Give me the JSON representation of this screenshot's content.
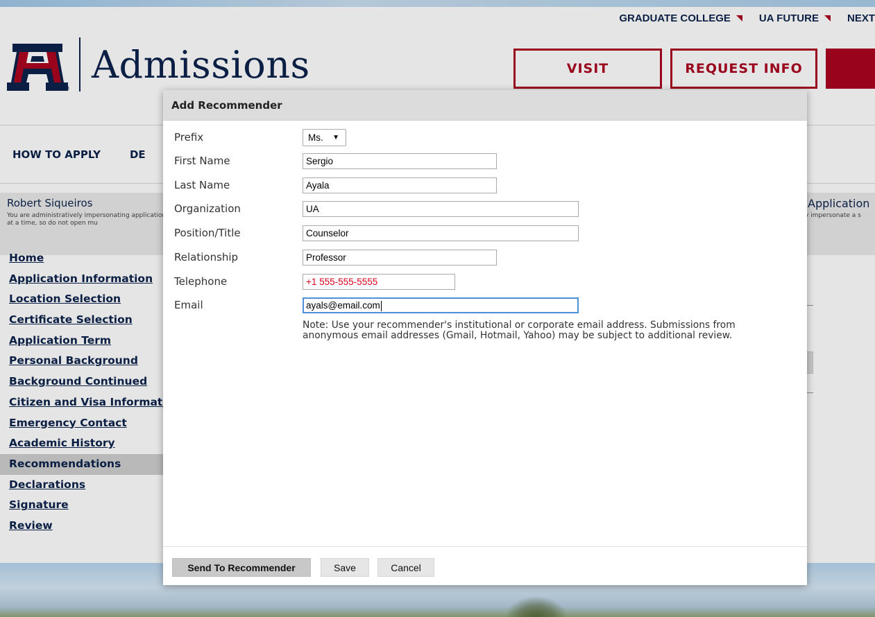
{
  "top_nav": {
    "items": [
      "GRADUATE COLLEGE",
      "UA FUTURE",
      "NEXT"
    ]
  },
  "header": {
    "logo_text": "Admissions",
    "visit_label": "VISIT",
    "request_info_label": "REQUEST INFO"
  },
  "main_nav": {
    "items": [
      "HOW TO APPLY",
      "DE"
    ]
  },
  "user": {
    "name": "Robert Siqueiros",
    "note": "You are administratively impersonating application at a time, so do not open mu",
    "right_title": "Application",
    "right_note": "y impersonate a s"
  },
  "sidebar": {
    "items": [
      "Home",
      "Application Information",
      "Location Selection",
      "Certificate Selection",
      "Application Term",
      "Personal Background",
      "Background Continued",
      "Citizen and Visa Information",
      "Emergency Contact",
      "Academic History",
      "Recommendations",
      "Declarations",
      "Signature",
      "Review"
    ],
    "active": "Recommendations"
  },
  "modal": {
    "title": "Add Recommender",
    "fields": {
      "prefix": {
        "label": "Prefix",
        "value": "Ms."
      },
      "first_name": {
        "label": "First Name",
        "value": "Sergio"
      },
      "last_name": {
        "label": "Last Name",
        "value": "Ayala"
      },
      "organization": {
        "label": "Organization",
        "value": "UA"
      },
      "position": {
        "label": "Position/Title",
        "value": "Counselor"
      },
      "relationship": {
        "label": "Relationship",
        "value": "Professor"
      },
      "telephone": {
        "label": "Telephone",
        "value": "+1 555-555-5555"
      },
      "email": {
        "label": "Email",
        "value": "ayals@email.com"
      }
    },
    "note": "Note: Use your recommender's institutional or corporate email address. Submissions from anonymous email addresses (Gmail, Hotmail, Yahoo) may be subject to additional review.",
    "buttons": {
      "send": "Send To Recommender",
      "save": "Save",
      "cancel": "Cancel"
    }
  },
  "colors": {
    "navy": "#0c234b",
    "red": "#ab0520",
    "telephone_text": "#e0001b"
  }
}
